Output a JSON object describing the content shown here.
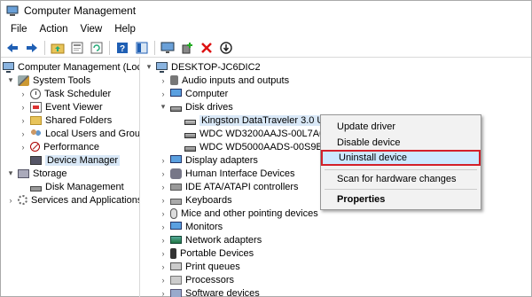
{
  "window": {
    "title": "Computer Management"
  },
  "menu": [
    "File",
    "Action",
    "View",
    "Help"
  ],
  "toolbar_icons": [
    "back-icon",
    "forward-icon",
    "up-folder-icon",
    "properties-icon",
    "refresh-icon",
    "help-icon",
    "show-hide-icon",
    "monitor-icon",
    "add-driver-icon",
    "remove-icon",
    "install-icon"
  ],
  "left_tree": {
    "root": "Computer Management (Local",
    "system_tools": "System Tools",
    "task_scheduler": "Task Scheduler",
    "event_viewer": "Event Viewer",
    "shared_folders": "Shared Folders",
    "local_users": "Local Users and Groups",
    "performance": "Performance",
    "device_manager": "Device Manager",
    "storage": "Storage",
    "disk_management": "Disk Management",
    "services": "Services and Applications"
  },
  "device_tree": {
    "computer_name": "DESKTOP-JC6DIC2",
    "items": {
      "audio": "Audio inputs and outputs",
      "computer": "Computer",
      "disk_drives": "Disk drives",
      "kingston": "Kingston DataTraveler 3.0 USB D",
      "wdc1": "WDC WD3200AAJS-00L7A0 A",
      "wdc2": "WDC WD5000AADS-00S9B0 A",
      "display": "Display adapters",
      "hid": "Human Interface Devices",
      "ide": "IDE ATA/ATAPI controllers",
      "keyboards": "Keyboards",
      "mice": "Mice and other pointing devices",
      "monitors": "Monitors",
      "network": "Network adapters",
      "portable": "Portable Devices",
      "print": "Print queues",
      "processors": "Processors",
      "software": "Software devices"
    }
  },
  "context_menu": {
    "update": "Update driver",
    "disable": "Disable device",
    "uninstall": "Uninstall device",
    "scan": "Scan for hardware changes",
    "properties": "Properties"
  },
  "colors": {
    "highlight_border": "#d3202a",
    "selection_bg": "#d9e8f7",
    "menu_hover": "#cde8ff"
  }
}
